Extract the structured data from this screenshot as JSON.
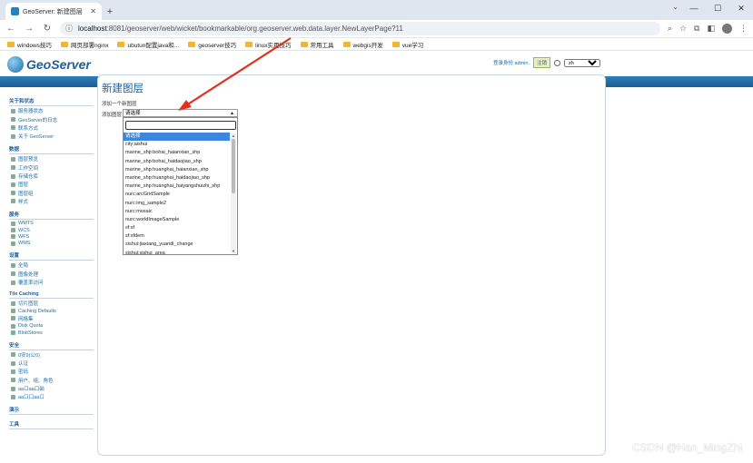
{
  "browser": {
    "tab_title": "GeoServer: 新建图层",
    "url_host": "localhost",
    "url_rest": ":8081/geoserver/web/wicket/bookmarkable/org.geoserver.web.data.layer.NewLayerPage?11",
    "bookmarks": [
      "windows技巧",
      "网页部署nginx",
      "ubutun配置java和...",
      "geoserver技巧",
      "linux实用技巧",
      "常用工具",
      "webgis开发",
      "vue学习"
    ]
  },
  "header": {
    "logo_text": "GeoServer",
    "login_text": "登录身份 admin.",
    "logout_label": "注销",
    "lang_value": "zh"
  },
  "sidebar": {
    "sections": [
      {
        "title": "关于和状态",
        "items": [
          "服务器状态",
          "GeoServer的日志",
          "联系方式",
          "关于 GeoServer"
        ]
      },
      {
        "title": "数据",
        "items": [
          "图层预览",
          "工作空间",
          "存储仓库",
          "图层",
          "图层组",
          "样式"
        ]
      },
      {
        "title": "服务",
        "items": [
          "WMTS",
          "WCS",
          "WFS",
          "WMS"
        ]
      },
      {
        "title": "设置",
        "items": [
          "全局",
          "图像处理",
          "覆盖率访问"
        ]
      },
      {
        "title": "Tile Caching",
        "items": [
          "切片图层",
          "Caching Defaults",
          "网格集",
          "Disk Quota",
          "BlobStores"
        ]
      },
      {
        "title": "安全",
        "items": [
          "0安9(公0)",
          "认证",
          "密码",
          "用户、组、角色",
          "aa口aa口础",
          "aa口口aa口"
        ]
      },
      {
        "title": "演示",
        "items": []
      },
      {
        "title": "工具",
        "items": []
      }
    ]
  },
  "main": {
    "title": "新建图层",
    "subtitle": "添加一个新图层",
    "layer_label": "添加图层",
    "select_value": "请选择",
    "options": [
      "请选择",
      "city:aishui",
      "marine_shp:bohai_haianxian_shp",
      "marine_shp:bohai_haidaojiao_shp",
      "marine_shp:huanghai_haianxian_shp",
      "marine_shp:huanghai_haidaojiao_shp",
      "marine_shp:huanghai_haiyangshuizhi_shp",
      "nurc:arcGridSample",
      "nurc:img_sample2",
      "nurc:mosaic",
      "nurc:worldImageSample",
      "sf:sf",
      "sf:sfdem",
      "sishui:jiaxiang_yuandi_change",
      "sishui:sishui_area"
    ]
  },
  "watermark": "CSDN @Han_MingZhi",
  "colors": {
    "accent": "#1f5f96",
    "band": "#2e7dba",
    "selected": "#3b87e0"
  }
}
